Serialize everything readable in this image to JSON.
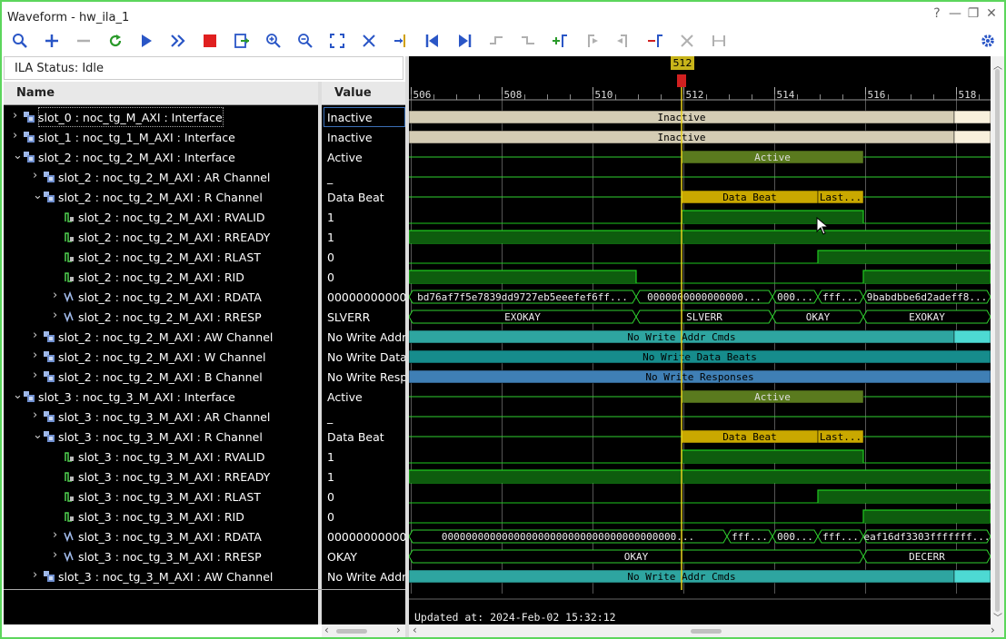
{
  "window": {
    "title": "Waveform - hw_ila_1",
    "controls": [
      "?",
      "—",
      "❐",
      "✕"
    ]
  },
  "toolbar": {
    "icons": [
      "search-icon",
      "add-icon",
      "remove-icon",
      "refresh-icon",
      "run-icon",
      "run-all-icon",
      "stop-icon",
      "export-icon",
      "zoom-in-icon",
      "zoom-out-icon",
      "zoom-fit-icon",
      "cursor-snap-icon",
      "marker-icon",
      "go-first-icon",
      "go-last-icon",
      "prev-transition-icon",
      "next-transition-icon",
      "add-marker-icon",
      "prev-marker-icon",
      "next-marker-icon",
      "swap-cursor-icon",
      "delete-marker-icon",
      "span-icon",
      "settings-icon"
    ]
  },
  "status": {
    "label": "ILA Status: Idle"
  },
  "headers": {
    "name": "Name",
    "value": "Value"
  },
  "signals": [
    {
      "name": "slot_0 : noc_tg_M_AXI : Interface",
      "value": "Inactive",
      "indent": 0,
      "chev": "›",
      "icon": "bus"
    },
    {
      "name": "slot_1 : noc_tg_1_M_AXI : Interface",
      "value": "Inactive",
      "indent": 0,
      "chev": "›",
      "icon": "bus"
    },
    {
      "name": "slot_2 : noc_tg_2_M_AXI : Interface",
      "value": "Active",
      "indent": 0,
      "chev": "⌄",
      "icon": "bus"
    },
    {
      "name": "slot_2 : noc_tg_2_M_AXI : AR Channel",
      "value": "_",
      "indent": 1,
      "chev": "›",
      "icon": "bus"
    },
    {
      "name": "slot_2 : noc_tg_2_M_AXI : R Channel",
      "value": "Data Beat",
      "indent": 1,
      "chev": "⌄",
      "icon": "bus"
    },
    {
      "name": "slot_2 : noc_tg_2_M_AXI : RVALID",
      "value": "1",
      "indent": 2,
      "chev": "",
      "icon": "bit"
    },
    {
      "name": "slot_2 : noc_tg_2_M_AXI : RREADY",
      "value": "1",
      "indent": 2,
      "chev": "",
      "icon": "bit"
    },
    {
      "name": "slot_2 : noc_tg_2_M_AXI : RLAST",
      "value": "0",
      "indent": 2,
      "chev": "",
      "icon": "bit"
    },
    {
      "name": "slot_2 : noc_tg_2_M_AXI : RID",
      "value": "0",
      "indent": 2,
      "chev": "",
      "icon": "bit"
    },
    {
      "name": "slot_2 : noc_tg_2_M_AXI : RDATA",
      "value": "00000000000",
      "indent": 2,
      "chev": "›",
      "icon": "vec"
    },
    {
      "name": "slot_2 : noc_tg_2_M_AXI : RRESP",
      "value": "SLVERR",
      "indent": 2,
      "chev": "›",
      "icon": "vec"
    },
    {
      "name": "slot_2 : noc_tg_2_M_AXI : AW Channel",
      "value": "No Write Addr",
      "indent": 1,
      "chev": "›",
      "icon": "bus"
    },
    {
      "name": "slot_2 : noc_tg_2_M_AXI : W Channel",
      "value": "No Write Data",
      "indent": 1,
      "chev": "›",
      "icon": "bus"
    },
    {
      "name": "slot_2 : noc_tg_2_M_AXI : B Channel",
      "value": "No Write Resp",
      "indent": 1,
      "chev": "›",
      "icon": "bus"
    },
    {
      "name": "slot_3 : noc_tg_3_M_AXI : Interface",
      "value": "Active",
      "indent": 0,
      "chev": "⌄",
      "icon": "bus"
    },
    {
      "name": "slot_3 : noc_tg_3_M_AXI : AR Channel",
      "value": "_",
      "indent": 1,
      "chev": "›",
      "icon": "bus"
    },
    {
      "name": "slot_3 : noc_tg_3_M_AXI : R Channel",
      "value": "Data Beat",
      "indent": 1,
      "chev": "⌄",
      "icon": "bus"
    },
    {
      "name": "slot_3 : noc_tg_3_M_AXI : RVALID",
      "value": "1",
      "indent": 2,
      "chev": "",
      "icon": "bit"
    },
    {
      "name": "slot_3 : noc_tg_3_M_AXI : RREADY",
      "value": "1",
      "indent": 2,
      "chev": "",
      "icon": "bit"
    },
    {
      "name": "slot_3 : noc_tg_3_M_AXI : RLAST",
      "value": "0",
      "indent": 2,
      "chev": "",
      "icon": "bit"
    },
    {
      "name": "slot_3 : noc_tg_3_M_AXI : RID",
      "value": "0",
      "indent": 2,
      "chev": "",
      "icon": "bit"
    },
    {
      "name": "slot_3 : noc_tg_3_M_AXI : RDATA",
      "value": "00000000000",
      "indent": 2,
      "chev": "›",
      "icon": "vec"
    },
    {
      "name": "slot_3 : noc_tg_3_M_AXI : RRESP",
      "value": "OKAY",
      "indent": 2,
      "chev": "›",
      "icon": "vec"
    },
    {
      "name": "slot_3 : noc_tg_3_M_AXI : AW Channel",
      "value": "No Write Addr",
      "indent": 1,
      "chev": "›",
      "icon": "bus"
    }
  ],
  "timeline": {
    "ticks": [
      "506",
      "508",
      "510",
      "512",
      "514",
      "516",
      "518"
    ],
    "start": 505.95,
    "end": 518.75,
    "cursor_time": 511.95,
    "cursor_label": "512",
    "updated": "Updated at: 2024-Feb-02 15:32:12"
  },
  "waves": [
    {
      "type": "bus",
      "segs": [
        [
          505.95,
          517.95,
          "Inactive",
          "#d4ccb4",
          "#000"
        ],
        [
          517.95,
          518.75,
          "",
          "#f8f0dc",
          "#000"
        ]
      ]
    },
    {
      "type": "bus",
      "segs": [
        [
          505.95,
          517.95,
          "Inactive",
          "#d4ccb4",
          "#000"
        ],
        [
          517.95,
          518.75,
          "",
          "#f8f0dc",
          "#000"
        ]
      ]
    },
    {
      "type": "bus",
      "segs": [
        [
          511.95,
          515.95,
          "Active",
          "#5a7a1e",
          "#ddd"
        ]
      ]
    },
    {
      "type": "line"
    },
    {
      "type": "bus",
      "segs": [
        [
          511.95,
          514.95,
          "Data Beat",
          "#c9a800",
          "#000"
        ],
        [
          514.95,
          515.95,
          "Last...",
          "#c9a800",
          "#000"
        ]
      ]
    },
    {
      "type": "bit",
      "high": [
        [
          511.95,
          515.95
        ]
      ]
    },
    {
      "type": "bit",
      "high": [
        [
          505.95,
          518.75
        ]
      ]
    },
    {
      "type": "bit",
      "high": [
        [
          514.95,
          518.75
        ]
      ]
    },
    {
      "type": "bit",
      "high": [
        [
          505.95,
          510.95
        ],
        [
          515.95,
          518.75
        ]
      ]
    },
    {
      "type": "hex",
      "segs": [
        [
          505.95,
          510.95,
          "bd76af7f5e7839dd9727eb5eeefef6ff..."
        ],
        [
          510.95,
          513.95,
          "0000000000000000..."
        ],
        [
          513.95,
          514.95,
          "000..."
        ],
        [
          514.95,
          515.95,
          "fff..."
        ],
        [
          515.95,
          518.75,
          "9babdbbe6d2adeff8..."
        ]
      ]
    },
    {
      "type": "hex",
      "segs": [
        [
          505.95,
          510.95,
          "EXOKAY"
        ],
        [
          510.95,
          513.95,
          "SLVERR"
        ],
        [
          513.95,
          515.95,
          "OKAY"
        ],
        [
          515.95,
          518.75,
          "EXOKAY"
        ]
      ]
    },
    {
      "type": "bus",
      "segs": [
        [
          505.95,
          517.95,
          "No Write Addr Cmds",
          "#2ea5a0",
          "#000"
        ],
        [
          517.95,
          518.75,
          "",
          "#4dd9d3",
          "#000"
        ]
      ]
    },
    {
      "type": "bus",
      "segs": [
        [
          505.95,
          518.75,
          "No Write Data Beats",
          "#168c8c",
          "#000"
        ]
      ]
    },
    {
      "type": "bus",
      "segs": [
        [
          505.95,
          518.75,
          "No Write Responses",
          "#3f7fb5",
          "#000"
        ]
      ]
    },
    {
      "type": "bus",
      "segs": [
        [
          511.95,
          515.95,
          "Active",
          "#5a7a1e",
          "#ddd"
        ]
      ]
    },
    {
      "type": "line"
    },
    {
      "type": "bus",
      "segs": [
        [
          511.95,
          514.95,
          "Data Beat",
          "#c9a800",
          "#000"
        ],
        [
          514.95,
          515.95,
          "Last...",
          "#c9a800",
          "#000"
        ]
      ]
    },
    {
      "type": "bit",
      "high": [
        [
          511.95,
          515.95
        ]
      ]
    },
    {
      "type": "bit",
      "high": [
        [
          505.95,
          518.75
        ]
      ]
    },
    {
      "type": "bit",
      "high": [
        [
          514.95,
          518.75
        ]
      ]
    },
    {
      "type": "bit",
      "high": [
        [
          515.95,
          518.75
        ]
      ]
    },
    {
      "type": "hex",
      "segs": [
        [
          505.95,
          512.95,
          "000000000000000000000000000000000000000..."
        ],
        [
          512.95,
          513.95,
          "fff..."
        ],
        [
          513.95,
          514.95,
          "000..."
        ],
        [
          514.95,
          515.95,
          "fff..."
        ],
        [
          515.95,
          518.75,
          "eaf16df3303fffffff..."
        ]
      ]
    },
    {
      "type": "hex",
      "segs": [
        [
          505.95,
          515.95,
          "OKAY"
        ],
        [
          515.95,
          518.75,
          "DECERR"
        ]
      ]
    },
    {
      "type": "bus",
      "segs": [
        [
          505.95,
          517.95,
          "No Write Addr Cmds",
          "#2ea5a0",
          "#000"
        ],
        [
          517.95,
          518.75,
          "",
          "#4dd9d3",
          "#000"
        ]
      ]
    }
  ],
  "colors": {
    "bit": "#1ec81e",
    "bitfill": "#0e5c0e",
    "grid": "#555555",
    "cursor": "#e8d21e",
    "hexline": "#2fd02f"
  }
}
